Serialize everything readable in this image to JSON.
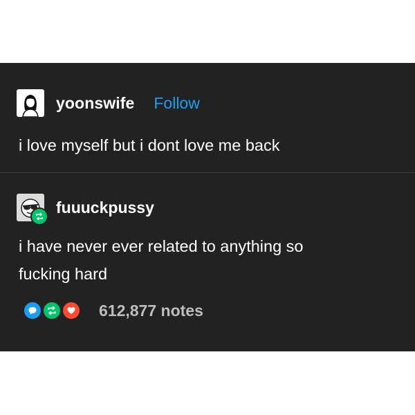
{
  "post": {
    "original": {
      "username": "yoonswife",
      "follow_label": "Follow",
      "avatar_icon": "girl-portrait-avatar",
      "text": "i love myself but i dont love me back"
    },
    "reblog": {
      "username": "fuuuckpussy",
      "avatar_icon": "sunglasses-avatar",
      "badge_icon": "reblog-icon",
      "lines": [
        "i have never ever related to anything so",
        "fucking hard"
      ]
    },
    "notes": {
      "count_label": "612,877 notes",
      "icons": [
        "comment-icon",
        "reblog-icon",
        "heart-icon"
      ]
    }
  },
  "colors": {
    "post_bg": "#222222",
    "follow": "#1aa0f5",
    "comment": "#1c9cf0",
    "reblog": "#00c46a",
    "like": "#ff4930"
  }
}
